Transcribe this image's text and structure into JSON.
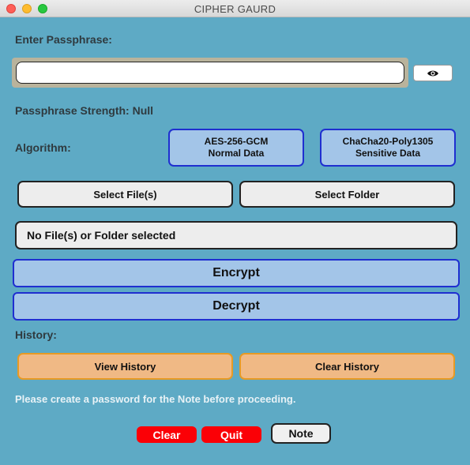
{
  "window": {
    "title": "CIPHER GAURD"
  },
  "passphrase": {
    "label": "Enter Passphrase:",
    "value": "",
    "placeholder": "",
    "toggle_icon": "eye-icon"
  },
  "strength": {
    "text": "Passphrase Strength: Null"
  },
  "algorithm": {
    "label": "Algorithm:",
    "options": [
      {
        "name": "AES-256-GCM",
        "desc": "Normal Data"
      },
      {
        "name": "ChaCha20-Poly1305",
        "desc": "Sensitive Data"
      }
    ]
  },
  "selection": {
    "file_label": "Select File(s)",
    "folder_label": "Select Folder",
    "status": "No File(s) or Folder selected"
  },
  "actions": {
    "encrypt": "Encrypt",
    "decrypt": "Decrypt"
  },
  "history": {
    "label": "History:",
    "view_label": "View History",
    "clear_label": "Clear History"
  },
  "note_message": "Please create a password for the Note before proceeding.",
  "footer": {
    "clear": "Clear",
    "quit": "Quit",
    "note": "Note"
  },
  "colors": {
    "background": "#5eaac5",
    "algo_button": "#a3c5e8",
    "algo_border": "#1f2fd0",
    "history_button": "#f0b985",
    "history_border": "#e79a24",
    "danger": "#fb0006"
  }
}
